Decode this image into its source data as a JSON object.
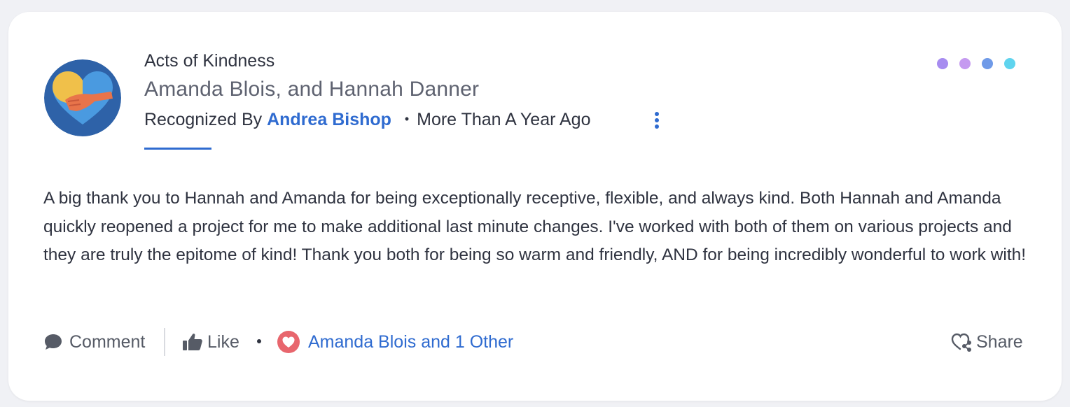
{
  "post": {
    "category": "Acts of Kindness",
    "recipients": "Amanda Blois, and Hannah Danner",
    "recognized_by_label": "Recognized By",
    "recognizer": "Andrea Bishop",
    "separator": "•",
    "time_ago": "More Than A Year Ago",
    "message": "A big thank you to Hannah and Amanda for being exceptionally receptive, flexible, and always kind. Both Hannah and Amanda quickly reopened a project for me to make additional last minute changes. I've worked with both of them on various projects and they are truly the epitome of kind! Thank you both for being so warm and friendly, AND for being incredibly wonderful to work with!"
  },
  "actions": {
    "comment_label": "Comment",
    "like_label": "Like",
    "likers_text": "Amanda Blois and 1 Other",
    "share_label": "Share"
  },
  "decor_dots": [
    "#a78cf0",
    "#c59af0",
    "#6f9ae8",
    "#5fd4ee"
  ],
  "colors": {
    "accent": "#2f6bd0",
    "heart_badge": "#e8666d",
    "card_bg": "#ffffff",
    "page_bg": "#f0f1f5"
  },
  "icons": {
    "badge": "heart-hand-badge-icon",
    "kebab": "kebab-menu-icon",
    "comment": "comment-bubble-icon",
    "like": "thumbs-up-icon",
    "likers": "heart-badge-icon",
    "share": "heart-share-icon"
  }
}
